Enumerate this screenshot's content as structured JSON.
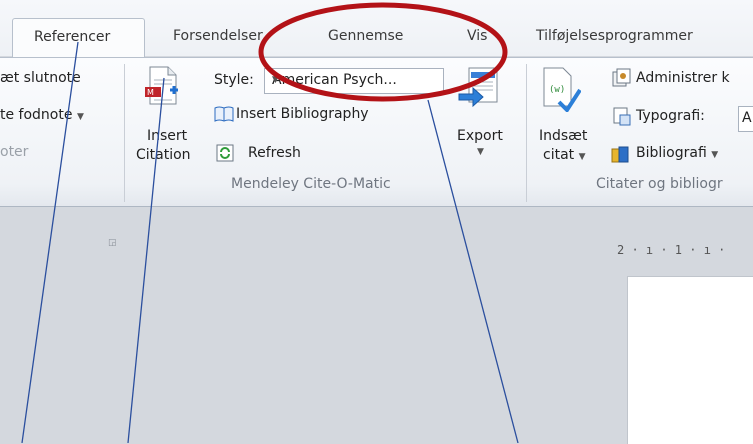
{
  "tabs": {
    "active": "Referencer",
    "others": [
      "Forsendelser",
      "Gennemse",
      "Vis",
      "Tilføjelsesprogrammer"
    ]
  },
  "footnotes_group": {
    "insert_endnote": "æt slutnote",
    "next_footnote": "te fodnote",
    "group_label": "oter"
  },
  "mendeley": {
    "style_label": "Style:",
    "style_value": "American Psych...",
    "insert_bibliography": "Insert Bibliography",
    "refresh": "Refresh",
    "insert_citation_line1": "Insert",
    "insert_citation_line2": "Citation",
    "export_label": "Export",
    "group_label": "Mendeley Cite-O-Matic"
  },
  "citations_group": {
    "insert_citation_line1": "Indsæt",
    "insert_citation_line2": "citat",
    "manage_sources": "Administrer k",
    "style_label": "Typografi:",
    "style_value": "A",
    "bibliography": "Bibliografi",
    "group_label": "Citater og bibliogr"
  },
  "ruler_text": "2 · ı · 1 · ı ·",
  "annotation": {
    "ellipse_color": "#b31217",
    "line_color": "#2b4f9e"
  }
}
